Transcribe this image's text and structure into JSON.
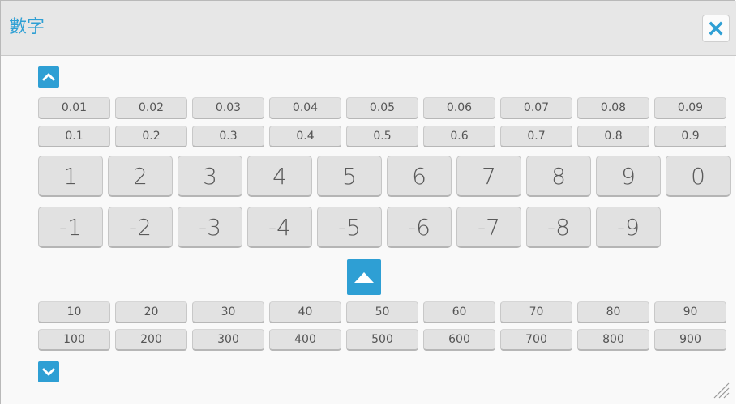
{
  "dialog": {
    "title": "數字",
    "close_icon": "close-icon",
    "accent_color": "#2e9fd4"
  },
  "nav": {
    "scroll_up_icon": "chevron-up-icon",
    "scroll_down_icon": "chevron-down-icon",
    "center_up_icon": "triangle-up-icon"
  },
  "decimals_hundredths": [
    "0.01",
    "0.02",
    "0.03",
    "0.04",
    "0.05",
    "0.06",
    "0.07",
    "0.08",
    "0.09"
  ],
  "decimals_tenths": [
    "0.1",
    "0.2",
    "0.3",
    "0.4",
    "0.5",
    "0.6",
    "0.7",
    "0.8",
    "0.9"
  ],
  "digits": [
    "1",
    "2",
    "3",
    "4",
    "5",
    "6",
    "7",
    "8",
    "9",
    "0"
  ],
  "negatives": [
    "-1",
    "-2",
    "-3",
    "-4",
    "-5",
    "-6",
    "-7",
    "-8",
    "-9"
  ],
  "tens": [
    "10",
    "20",
    "30",
    "40",
    "50",
    "60",
    "70",
    "80",
    "90"
  ],
  "hundreds": [
    "100",
    "200",
    "300",
    "400",
    "500",
    "600",
    "700",
    "800",
    "900"
  ]
}
